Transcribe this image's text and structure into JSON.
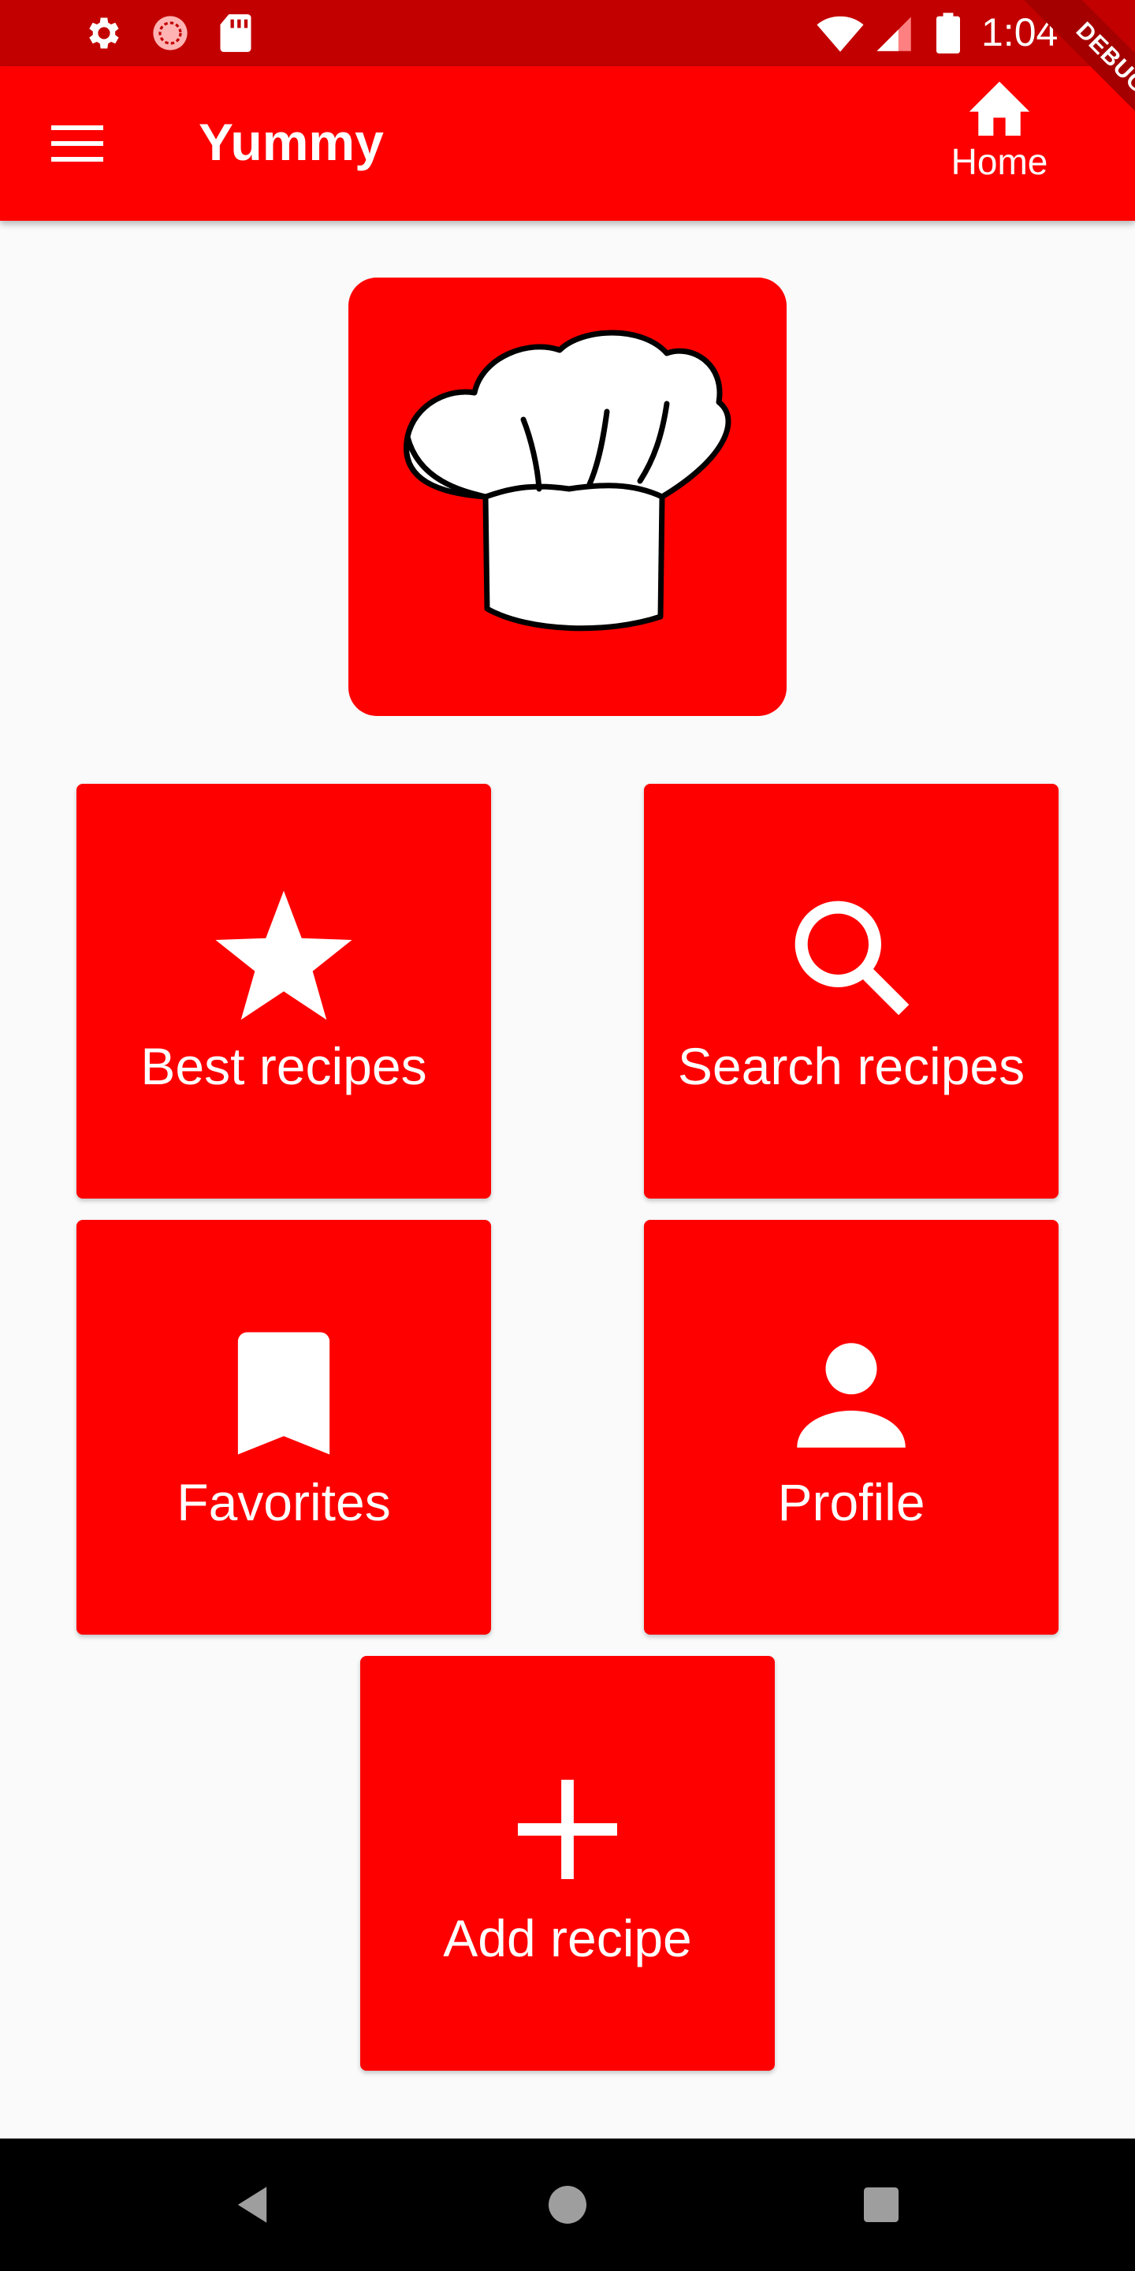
{
  "status_bar": {
    "time": "1:04",
    "icons": [
      "gear-icon",
      "sync-icon",
      "sd-card-icon",
      "wifi-icon",
      "signal-icon",
      "battery-icon"
    ]
  },
  "app_bar": {
    "title": "Yummy",
    "menu_icon": "menu-icon",
    "action": {
      "icon": "home-icon",
      "label": "Home"
    },
    "debug_banner": "DEBUG"
  },
  "logo": {
    "icon": "chef-hat-icon"
  },
  "tiles": [
    {
      "id": "best",
      "icon": "star-icon",
      "label": "Best recipes"
    },
    {
      "id": "search",
      "icon": "search-icon",
      "label": "Search recipes"
    },
    {
      "id": "favorites",
      "icon": "bookmark-icon",
      "label": "Favorites"
    },
    {
      "id": "profile",
      "icon": "person-icon",
      "label": "Profile"
    },
    {
      "id": "add",
      "icon": "plus-icon",
      "label": "Add recipe"
    }
  ],
  "nav_bar": {
    "buttons": [
      "back-icon",
      "home-circle-icon",
      "recents-icon"
    ]
  },
  "colors": {
    "primary": "#ff0000",
    "status_bar": "#c20000",
    "background": "#fafafa",
    "nav_bar": "#000000"
  }
}
